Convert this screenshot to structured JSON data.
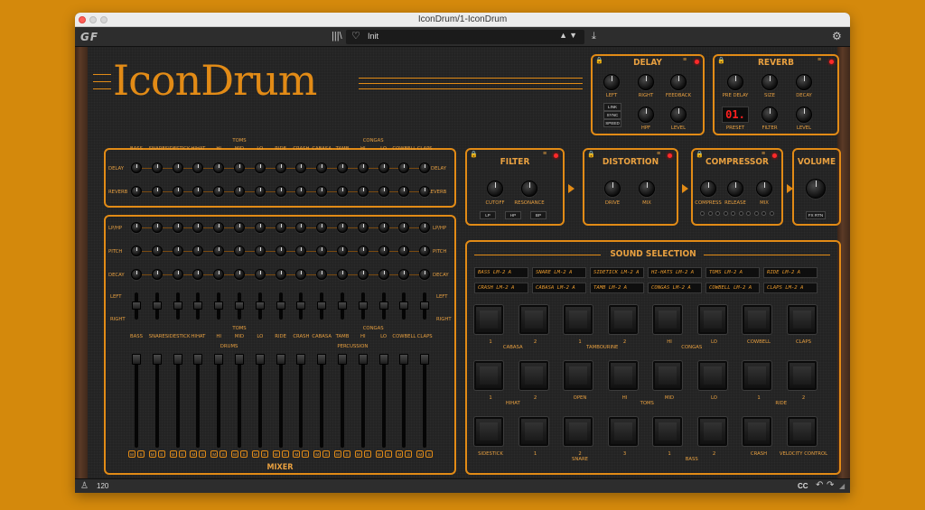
{
  "window": {
    "title": "IconDrum/1-IconDrum"
  },
  "toolbar": {
    "logo": "GF",
    "library_icon": "library-icon",
    "preset_name": "Init",
    "prev_next": "▲▼",
    "heart_icon": "heart-icon",
    "download_icon": "download-icon",
    "gear_icon": "gear-icon"
  },
  "plugin": {
    "logo": "IconDrum",
    "accent_color": "#e28b16",
    "delay": {
      "title": "DELAY",
      "knobs": [
        "LEFT",
        "RIGHT",
        "FEEDBACK",
        "HPF",
        "LEVEL"
      ],
      "sync_buttons": [
        "LINK",
        "SYNC",
        "SPEED"
      ]
    },
    "reverb": {
      "title": "REVERB",
      "knobs": [
        "PRE DELAY",
        "SIZE",
        "DECAY",
        "PRESET",
        "FILTER",
        "LEVEL"
      ],
      "preset_value": "01."
    },
    "sends": {
      "columns": [
        "BASS",
        "SNARE",
        "SIDESTICK",
        "HIHAT",
        "HI",
        "MID",
        "LO",
        "RIDE",
        "CRASH",
        "CABASA",
        "TAMB",
        "HI",
        "LO",
        "COWBELL",
        "CLAPS"
      ],
      "group_toms": "TOMS",
      "group_congas": "CONGAS",
      "rows": [
        "DELAY",
        "REVERB"
      ]
    },
    "channel": {
      "rows": [
        "LP/HP",
        "PITCH",
        "DECAY"
      ],
      "pan_left": "LEFT",
      "pan_right": "RIGHT",
      "columns": [
        "BASS",
        "SNARE",
        "SIDESTICK",
        "HIHAT",
        "HI",
        "MID",
        "LO",
        "RIDE",
        "CRASH",
        "CABASA",
        "TAMB",
        "HI",
        "LO",
        "COWBELL",
        "CLAPS"
      ],
      "group_toms": "TOMS",
      "group_congas": "CONGAS",
      "section_drums": "DRUMS",
      "section_percussion": "PERCUSSION",
      "mixer_title": "MIXER",
      "mute_labels": [
        "M",
        "S"
      ]
    },
    "filter": {
      "title": "FILTER",
      "knobs": [
        "CUTOFF",
        "RESONANCE"
      ],
      "modes": [
        "LP",
        "HP",
        "BP"
      ]
    },
    "distortion": {
      "title": "DISTORTION",
      "knobs": [
        "DRIVE",
        "MIX"
      ]
    },
    "compressor": {
      "title": "COMPRESSOR",
      "knobs": [
        "COMPRESS",
        "RELEASE",
        "MIX"
      ]
    },
    "volume": {
      "title": "VOLUME",
      "fx_btn": "FX RTN"
    },
    "sound_selection": {
      "title": "SOUND SELECTION",
      "slots": [
        "BASS LM-2 A",
        "SNARE LM-2 A",
        "SIDETICK LM-2 A",
        "HI-HATS LM-2 A",
        "TOMS LM-2 A",
        "RIDE LM-2 A",
        "CRASH LM-2 A",
        "CABASA LM-2 A",
        "TAMB LM-2 A",
        "CONGAS LM-2 A",
        "COWBELL LM-2 A",
        "CLAPS LM-2 A"
      ],
      "pad_row1": {
        "labels": [
          "1",
          "2",
          "1",
          "2",
          "HI",
          "LO",
          "COWBELL",
          "CLAPS"
        ],
        "groups": [
          "CABASA",
          "TAMBOURINE",
          "CONGAS"
        ]
      },
      "pad_row2": {
        "labels": [
          "1",
          "2",
          "OPEN",
          "HI",
          "MID",
          "LO",
          "1",
          "2"
        ],
        "groups": [
          "HIHAT",
          "TOMS",
          "RIDE"
        ]
      },
      "pad_row3": {
        "labels": [
          "SIDESTICK",
          "1",
          "2",
          "3",
          "1",
          "2",
          "CRASH",
          "VELOCITY CONTROL"
        ],
        "groups": [
          "SNARE",
          "BASS"
        ]
      }
    }
  },
  "statusbar": {
    "metronome_icon": "metronome-icon",
    "tempo": "120",
    "cc": "CC",
    "undo_icon": "undo-icon",
    "redo_icon": "redo-icon"
  }
}
